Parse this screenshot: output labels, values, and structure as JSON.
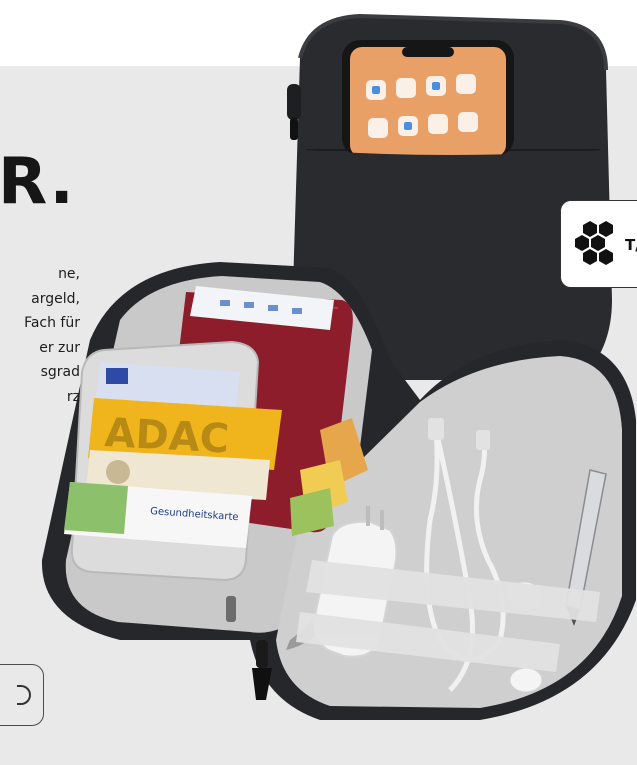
{
  "headline": {
    "text": "R."
  },
  "description": {
    "lines": [
      "ne,",
      "argeld,",
      "Fach für",
      "er zur",
      "sgrad",
      "rz"
    ]
  },
  "badge": {
    "text": "T/",
    "icon": "hexagon-cluster-icon"
  },
  "seal": {
    "icon": "seal-icon"
  },
  "product": {
    "type": "travel-organizer-wallet",
    "card_brand_text": "ADAC",
    "health_card_text": "Gesundheitskarte"
  },
  "colors": {
    "panel_background": "#e9e9e9",
    "pouch_shell": "#2a2b2e",
    "pouch_lining": "#c9c9c9",
    "passport_red": "#8e1d2b",
    "adac_yellow": "#f0b51c"
  }
}
